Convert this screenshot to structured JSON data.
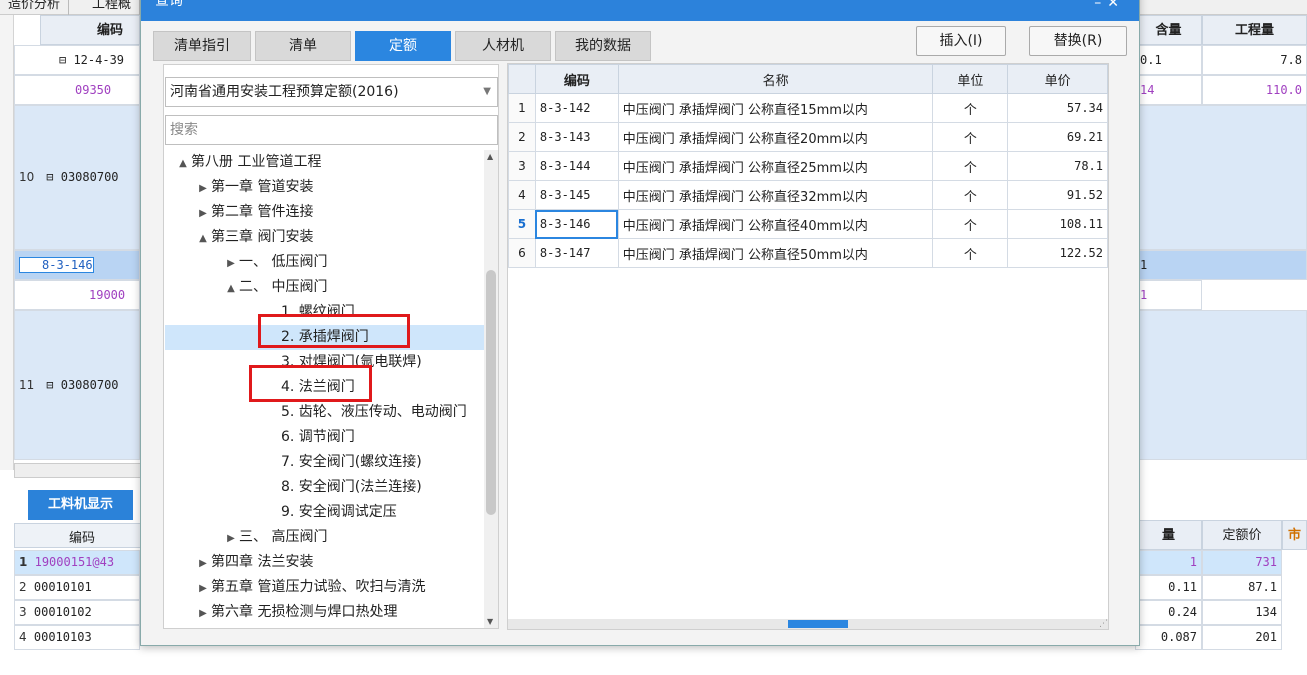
{
  "background": {
    "tabs": [
      "造价分析",
      "工程概"
    ],
    "grid_headers": [
      "编码",
      "含量",
      "工程量"
    ],
    "rows": [
      {
        "num": "",
        "code": "12-4-39",
        "qty": "0.1",
        "amount": "7.8"
      },
      {
        "num": "",
        "code": "09350",
        "qty": "14",
        "amount": "110.0"
      },
      {
        "num": "10",
        "code": "03080700",
        "qty": "",
        "amount": ""
      },
      {
        "num": "",
        "code": "8-3-146",
        "qty": "1",
        "amount": ""
      },
      {
        "num": "",
        "code": "19000",
        "qty": "1",
        "amount": ""
      },
      {
        "num": "11",
        "code": "03080700",
        "qty": "",
        "amount": ""
      }
    ],
    "bottom_tab": "工料机显示",
    "bottom_headers": [
      "编码",
      "量",
      "定额价",
      "市"
    ],
    "bottom_rows": [
      {
        "num": "1",
        "code": "19000151@43",
        "qty": "1",
        "price": "731"
      },
      {
        "num": "2",
        "code": "00010101",
        "qty": "0.11",
        "price": "87.1"
      },
      {
        "num": "3",
        "code": "00010102",
        "qty": "0.24",
        "price": "134"
      },
      {
        "num": "4",
        "code": "00010103",
        "qty": "0.087",
        "price": "201"
      }
    ]
  },
  "dialog": {
    "title": "查询",
    "tabs": [
      "清单指引",
      "清单",
      "定额",
      "人材机",
      "我的数据"
    ],
    "active_tab": "定额",
    "insert_label": "插入(I)",
    "replace_label": "替换(R)",
    "quota_library": "河南省通用安装工程预算定额(2016)",
    "search_placeholder": "搜索",
    "tree": [
      {
        "label": "第八册 工业管道工程",
        "level": 0,
        "arrow": "▲"
      },
      {
        "label": "第一章 管道安装",
        "level": 1,
        "arrow": "▶"
      },
      {
        "label": "第二章 管件连接",
        "level": 1,
        "arrow": "▶"
      },
      {
        "label": "第三章 阀门安装",
        "level": 1,
        "arrow": "▲"
      },
      {
        "label": "一、 低压阀门",
        "level": 2,
        "arrow": "▶"
      },
      {
        "label": "二、 中压阀门",
        "level": 2,
        "arrow": "▲"
      },
      {
        "label": "1. 螺纹阀门",
        "level": 3,
        "arrow": ""
      },
      {
        "label": "2. 承插焊阀门",
        "level": 3,
        "arrow": ""
      },
      {
        "label": "3. 对焊阀门(氩电联焊)",
        "level": 3,
        "arrow": ""
      },
      {
        "label": "4. 法兰阀门",
        "level": 3,
        "arrow": ""
      },
      {
        "label": "5. 齿轮、液压传动、电动阀门",
        "level": 3,
        "arrow": ""
      },
      {
        "label": "6. 调节阀门",
        "level": 3,
        "arrow": ""
      },
      {
        "label": "7. 安全阀门(螺纹连接)",
        "level": 3,
        "arrow": ""
      },
      {
        "label": "8. 安全阀门(法兰连接)",
        "level": 3,
        "arrow": ""
      },
      {
        "label": "9. 安全阀调试定压",
        "level": 3,
        "arrow": ""
      },
      {
        "label": "三、 高压阀门",
        "level": 2,
        "arrow": "▶"
      },
      {
        "label": "第四章 法兰安装",
        "level": 1,
        "arrow": "▶"
      },
      {
        "label": "第五章 管道压力试验、吹扫与清洗",
        "level": 1,
        "arrow": "▶"
      },
      {
        "label": "第六章 无损检测与焊口热处理",
        "level": 1,
        "arrow": "▶"
      }
    ],
    "table": {
      "headers": [
        "编码",
        "名称",
        "单位",
        "单价"
      ],
      "rows": [
        {
          "num": "1",
          "code": "8-3-142",
          "name": "中压阀门 承插焊阀门 公称直径15mm以内",
          "unit": "个",
          "price": "57.34"
        },
        {
          "num": "2",
          "code": "8-3-143",
          "name": "中压阀门 承插焊阀门 公称直径20mm以内",
          "unit": "个",
          "price": "69.21"
        },
        {
          "num": "3",
          "code": "8-3-144",
          "name": "中压阀门 承插焊阀门 公称直径25mm以内",
          "unit": "个",
          "price": "78.1"
        },
        {
          "num": "4",
          "code": "8-3-145",
          "name": "中压阀门 承插焊阀门 公称直径32mm以内",
          "unit": "个",
          "price": "91.52"
        },
        {
          "num": "5",
          "code": "8-3-146",
          "name": "中压阀门 承插焊阀门 公称直径40mm以内",
          "unit": "个",
          "price": "108.11"
        },
        {
          "num": "6",
          "code": "8-3-147",
          "name": "中压阀门 承插焊阀门 公称直径50mm以内",
          "unit": "个",
          "price": "122.52"
        }
      ]
    }
  },
  "colors": {
    "accent": "#2b86e0",
    "highlight": "#e0191b",
    "selection": "#cfe6fb"
  }
}
